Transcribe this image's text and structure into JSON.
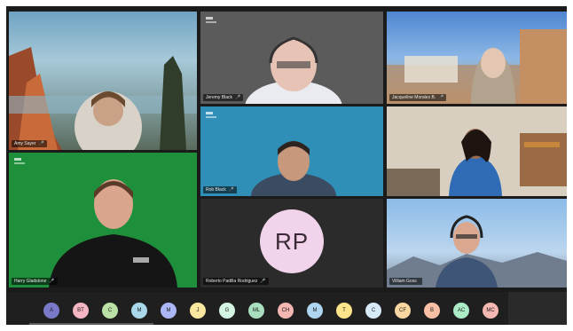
{
  "meeting": {
    "tiles": [
      {
        "name": "Amy Sayer",
        "mic": "🎤"
      },
      {
        "name": "Jeremy Black",
        "mic": "🎤"
      },
      {
        "name": "Jacqueline Morales B.",
        "mic": "🎤"
      },
      {
        "name": "Rob Black",
        "mic": "🎤"
      },
      {
        "name": "Harry Gladstone",
        "mic": "🎤"
      },
      {
        "name": "Frank Ulla",
        "mic": ""
      },
      {
        "name": "Roberto Padilla Rodriguez",
        "mic": "🎤",
        "initials": "RP"
      },
      {
        "name": "Villiam Goss",
        "mic": ""
      }
    ],
    "bottom_right_badge": "",
    "participants_strip": [
      {
        "initials": "A",
        "color": "#7a79c9"
      },
      {
        "initials": "BT",
        "color": "#f4b6c2"
      },
      {
        "initials": "C",
        "color": "#b9e0a5"
      },
      {
        "initials": "M",
        "color": "#a8d8ea"
      },
      {
        "initials": "M",
        "color": "#aab6f5"
      },
      {
        "initials": "J",
        "color": "#f9e79f"
      },
      {
        "initials": "G",
        "color": "#d5f5e3"
      },
      {
        "initials": "ML",
        "color": "#a9dfbf"
      },
      {
        "initials": "CH",
        "color": "#f5b7b1"
      },
      {
        "initials": "M",
        "color": "#aed6f1"
      },
      {
        "initials": "T",
        "color": "#fde68a"
      },
      {
        "initials": "C",
        "color": "#d6eaf8"
      },
      {
        "initials": "CF",
        "color": "#fad7a0"
      },
      {
        "initials": "B",
        "color": "#f9c0a5"
      },
      {
        "initials": "AC",
        "color": "#abebc6"
      },
      {
        "initials": "MC",
        "color": "#f5b7b1"
      },
      {
        "initials": "RA",
        "color": "#fdebd0"
      }
    ]
  }
}
